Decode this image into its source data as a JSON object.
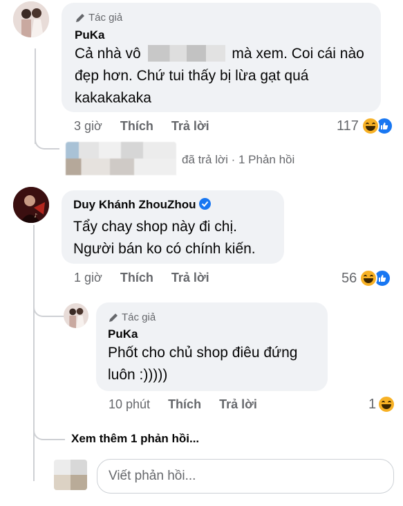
{
  "comment1": {
    "author_tag": "Tác giả",
    "author": "PuKa",
    "text_before": "Cả nhà vô",
    "text_after": "mà xem. Coi cái nào",
    "text_line2": "đẹp hơn. Chứ tui thấy bị lừa gạt quá",
    "text_line3": "kakakakaka",
    "time": "3 giờ",
    "like_label": "Thích",
    "reply_label": "Trả lời",
    "reaction_count": "117",
    "replied_text": "đã trả lời · 1 Phản hồi"
  },
  "comment2": {
    "author": "Duy Khánh ZhouZhou",
    "text_line1": "Tẩy chay shop này đi chị.",
    "text_line2": "Người bán ko có chính kiến.",
    "time": "1 giờ",
    "like_label": "Thích",
    "reply_label": "Trả lời",
    "reaction_count": "56"
  },
  "reply1": {
    "author_tag": "Tác giả",
    "author": "PuKa",
    "text_line1": "Phốt cho chủ shop điêu đứng",
    "text_line2": "luôn :)))))",
    "time": "10 phút",
    "like_label": "Thích",
    "reply_label": "Trả lời",
    "reaction_count": "1"
  },
  "more_replies": "Xem thêm 1 phản hồi...",
  "reply_input": {
    "placeholder": "Viết phản hồi..."
  },
  "colors": {
    "bubble": "#f0f2f5",
    "meta": "#65676b",
    "like_blue": "#1877f2",
    "haha_yellow": "#f7b125"
  },
  "icons": [
    "pencil-icon",
    "haha-reaction-icon",
    "like-reaction-icon",
    "verified-badge-icon"
  ]
}
